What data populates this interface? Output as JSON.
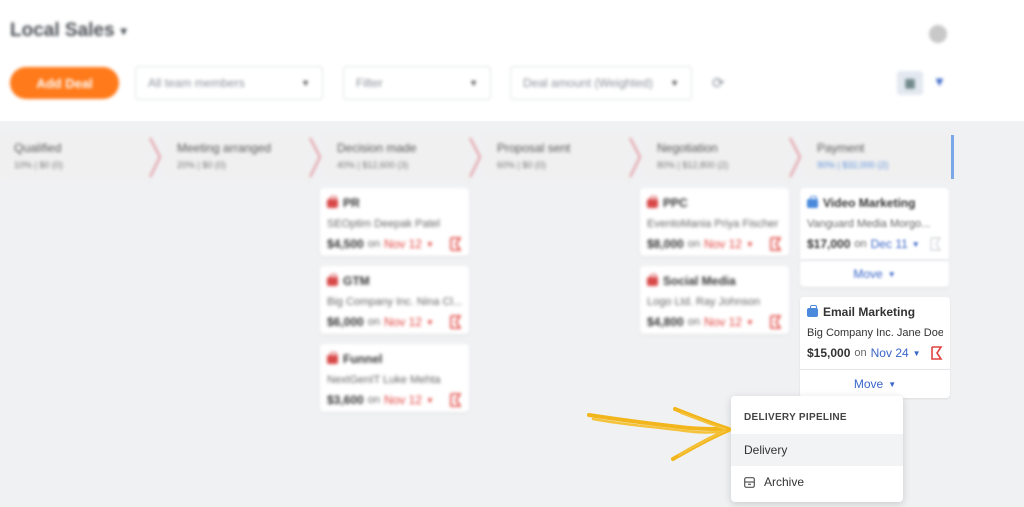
{
  "header": {
    "title": "Local Sales",
    "caret": "▾"
  },
  "toolbar": {
    "add_deal_label": "Add Deal",
    "team_filter": "All team members",
    "filter": "Filter",
    "deal_amount": "Deal amount (Weighted)"
  },
  "stages": [
    {
      "name": "Qualified",
      "meta": "10%  |  $0 (0)"
    },
    {
      "name": "Meeting arranged",
      "meta": "20%  |  $0 (0)"
    },
    {
      "name": "Decision made",
      "meta": "40%  |  $12,600 (3)"
    },
    {
      "name": "Proposal sent",
      "meta": "60%  |  $0 (0)"
    },
    {
      "name": "Negotiation",
      "meta": "80%  |  $12,800 (2)"
    },
    {
      "name": "Payment",
      "meta": "90%  |  $32,000 (2)"
    }
  ],
  "cards": {
    "pr": {
      "title": "PR",
      "sub": "SEOptim Deepak Patel",
      "amount": "$4,500",
      "on": "on",
      "date": "Nov 12"
    },
    "gtm": {
      "title": "GTM",
      "sub": "Big Company Inc. Nina Cl...",
      "amount": "$6,000",
      "on": "on",
      "date": "Nov 12"
    },
    "funnel": {
      "title": "Funnel",
      "sub": "NextGenIT Luke Mehta",
      "amount": "$3,600",
      "on": "on",
      "date": "Nov 12"
    },
    "ppc": {
      "title": "PPC",
      "sub": "EventoMania Priya Fischer",
      "amount": "$8,000",
      "on": "on",
      "date": "Nov 12"
    },
    "social": {
      "title": "Social Media",
      "sub": "Logo Ltd. Ray Johnson",
      "amount": "$4,800",
      "on": "on",
      "date": "Nov 12"
    },
    "video": {
      "title": "Video Marketing",
      "sub": "Vanguard Media Morgo...",
      "amount": "$17,000",
      "on": "on",
      "date": "Dec 11"
    },
    "email": {
      "title": "Email Marketing",
      "company": "Big Company Inc.",
      "contact": "Jane Doe",
      "amount": "$15,000",
      "on": "on",
      "date": "Nov 24"
    }
  },
  "move_label": "Move",
  "dropdown": {
    "header": "DELIVERY PIPELINE",
    "items": [
      "Delivery",
      "Archive"
    ]
  },
  "colors": {
    "accent": "#ff7a1a",
    "link": "#3a66c7",
    "overdue": "#e0443f",
    "annotation_arrow": "#f2b51b"
  }
}
